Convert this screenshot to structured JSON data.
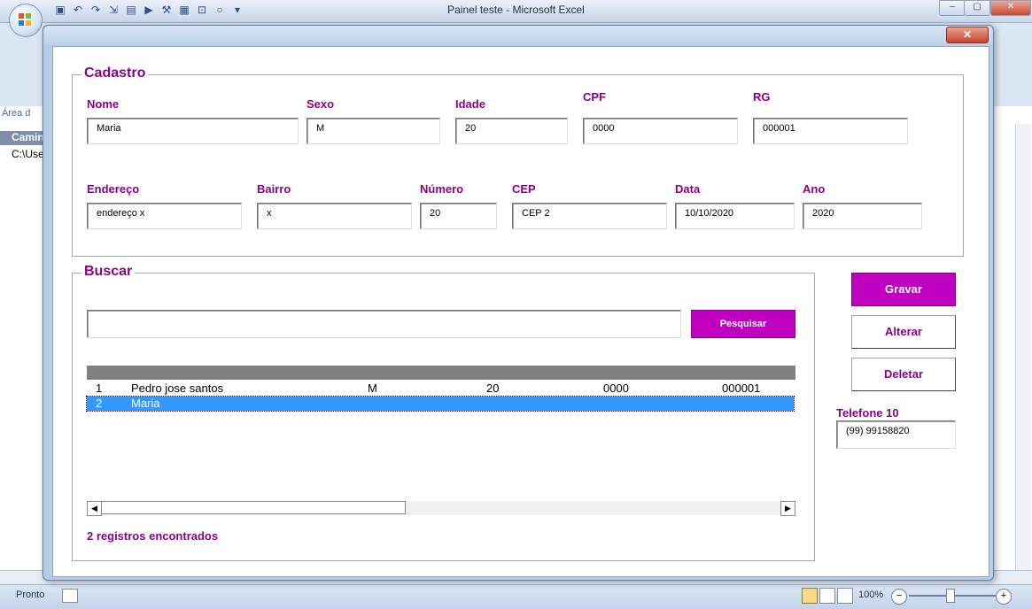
{
  "window": {
    "title": "Painel teste - Microsoft Excel",
    "minimize": "–",
    "maximize": "▢",
    "close": "✕"
  },
  "excel": {
    "status": "Pronto",
    "zoom": "100%",
    "side_snippets": [
      "Área d",
      "Camin",
      "C:\\Use"
    ]
  },
  "dialog": {
    "close_label": "✕",
    "cadastro": {
      "legend": "Cadastro",
      "fields": [
        {
          "label": "Nome",
          "value": "Maria"
        },
        {
          "label": "Sexo",
          "value": "M"
        },
        {
          "label": "Idade",
          "value": "20"
        },
        {
          "label": "CPF",
          "value": "0000"
        },
        {
          "label": "RG",
          "value": "000001"
        },
        {
          "label": "Endereço",
          "value": "endereço x"
        },
        {
          "label": "Bairro",
          "value": "x"
        },
        {
          "label": "Número",
          "value": "20"
        },
        {
          "label": "CEP",
          "value": "CEP 2"
        },
        {
          "label": "Data",
          "value": "10/10/2020"
        },
        {
          "label": "Ano",
          "value": "2020"
        }
      ]
    },
    "buscar": {
      "legend": "Buscar",
      "search_value": "",
      "search_button": "Pesquisar",
      "rows": [
        {
          "id": "1",
          "nome": "Pedro jose santos",
          "sexo": "M",
          "idade": "20",
          "cpf": "0000",
          "rg": "000001"
        },
        {
          "id": "2",
          "nome": "Maria",
          "sexo": "",
          "idade": "",
          "cpf": "",
          "rg": ""
        }
      ],
      "selected_row": 2,
      "result_text": "2 registros encontrados"
    },
    "buttons": {
      "gravar": "Gravar",
      "alterar": "Alterar",
      "deletar": "Deletar"
    },
    "telefone": {
      "label": "Telefone 10",
      "value": "(99) 99158820"
    }
  }
}
